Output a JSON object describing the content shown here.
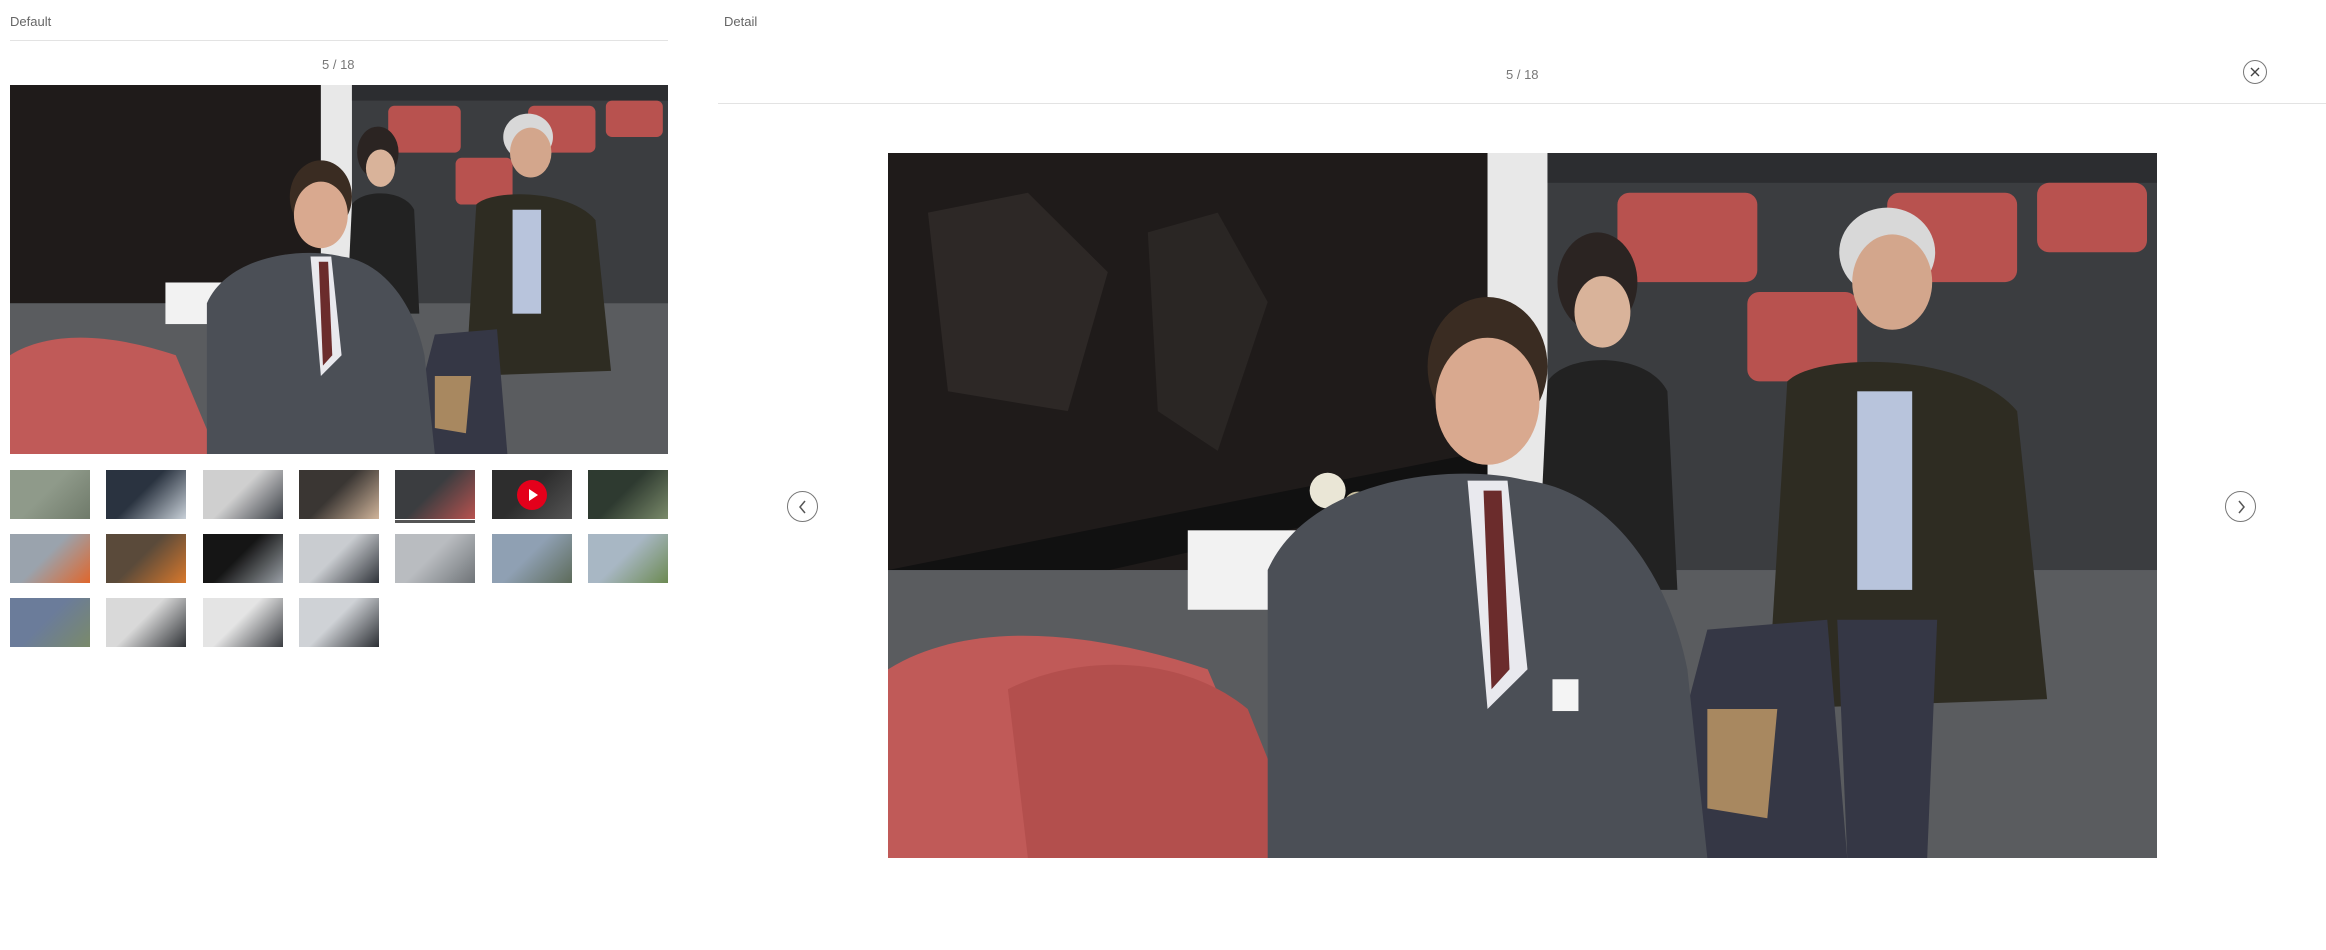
{
  "default_panel": {
    "label": "Default",
    "counter": "5 / 18",
    "thumbnails": [
      {
        "scene": "fog"
      },
      {
        "scene": "cab"
      },
      {
        "scene": "group-light"
      },
      {
        "scene": "group-dark"
      },
      {
        "scene": "train-interior",
        "active": true
      },
      {
        "scene": "video",
        "video": true
      },
      {
        "scene": "station"
      },
      {
        "scene": "workers"
      },
      {
        "scene": "tunnel-worker"
      },
      {
        "scene": "tunnel"
      },
      {
        "scene": "press"
      },
      {
        "scene": "portal"
      },
      {
        "scene": "city"
      },
      {
        "scene": "trees"
      },
      {
        "scene": "bridge"
      },
      {
        "scene": "handshake"
      },
      {
        "scene": "meeting"
      },
      {
        "scene": "crowd"
      }
    ]
  },
  "detail_panel": {
    "label": "Detail",
    "counter": "5 / 18",
    "close_icon": "close-icon",
    "prev_icon": "chevron-left-icon",
    "next_icon": "chevron-right-icon"
  },
  "colors": {
    "seat_red": "#b8524f",
    "play_red": "#e4001b",
    "suit_gray": "#4b4f56"
  }
}
